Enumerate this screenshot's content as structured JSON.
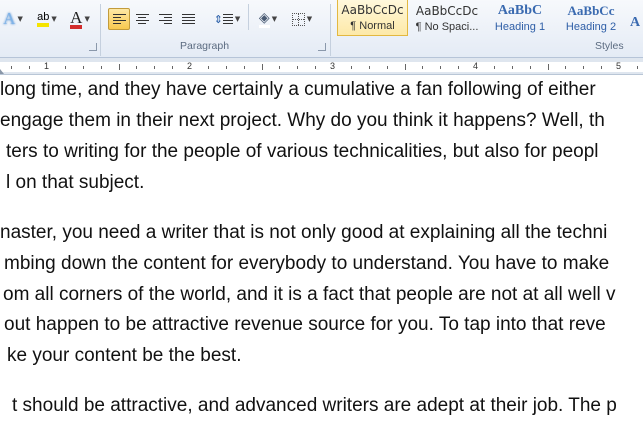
{
  "ribbon": {
    "paragraph_group_label": "Paragraph",
    "styles_group_label": "Styles",
    "font_tools": {
      "text_effects_letter": "A",
      "highlight_letters": "ab",
      "font_color_letter": "A",
      "highlight_color": "#f5e400",
      "font_color": "#d22c2c"
    },
    "styles": [
      {
        "preview": "AaBbCcDc",
        "name": "¶ Normal",
        "selected": true
      },
      {
        "preview": "AaBbCcDc",
        "name": "¶ No Spaci...",
        "selected": false
      },
      {
        "preview": "AaBbC",
        "name": "Heading 1",
        "selected": false
      },
      {
        "preview": "AaBbCc",
        "name": "Heading 2",
        "selected": false
      },
      {
        "preview": "A",
        "name": "",
        "selected": false
      }
    ]
  },
  "ruler": {
    "numbers": [
      "1",
      "2",
      "3",
      "4",
      "5"
    ]
  },
  "document": {
    "lines": [
      "long time, and they have certainly a cumulative a fan following of either",
      "engage them in their next project. Why do you think it happens? Well, th",
      "ters to writing for the people of various technicalities, but also for peopl",
      "l on that subject.",
      "naster, you need a writer that is not only good at explaining all the techni",
      "mbing down the content for everybody to understand. You have to make",
      "om all corners of the world, and it is a fact that people are not at all well v",
      "out happen to be attractive revenue source for you. To tap into that reve",
      "ke your content be the best.",
      "t should be attractive, and advanced writers are adept at their job. The p"
    ]
  }
}
